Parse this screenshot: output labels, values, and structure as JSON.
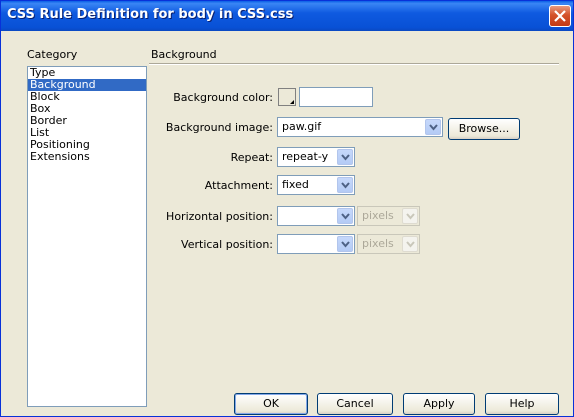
{
  "window": {
    "title": "CSS Rule Definition for body in CSS.css"
  },
  "category": {
    "header": "Category",
    "items": [
      "Type",
      "Background",
      "Block",
      "Box",
      "Border",
      "List",
      "Positioning",
      "Extensions"
    ],
    "selected": "Background"
  },
  "section": {
    "title": "Background"
  },
  "form": {
    "bg_color_label": "Background color:",
    "bg_color_value": "",
    "bg_image_label": "Background image:",
    "bg_image_value": "paw.gif",
    "browse_label": "Browse...",
    "repeat_label": "Repeat:",
    "repeat_value": "repeat-y",
    "attachment_label": "Attachment:",
    "attachment_value": "fixed",
    "hpos_label": "Horizontal position:",
    "hpos_value": "",
    "hpos_unit": "pixels",
    "vpos_label": "Vertical position:",
    "vpos_value": "",
    "vpos_unit": "pixels"
  },
  "buttons": {
    "ok": "OK",
    "cancel": "Cancel",
    "apply": "Apply",
    "help": "Help"
  },
  "colors": {
    "titlebar": "#0a5fe6",
    "selection": "#316ac5",
    "dialog_bg": "#ece9d8"
  }
}
